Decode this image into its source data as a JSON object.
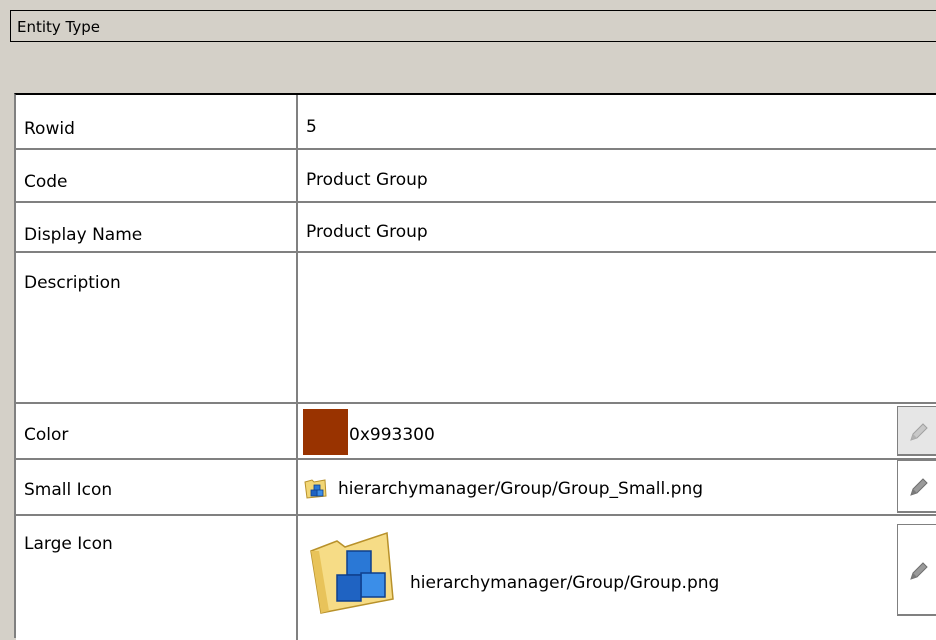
{
  "panel": {
    "title": "Entity Type"
  },
  "fields": {
    "rowid": {
      "label": "Rowid",
      "value": "5"
    },
    "code": {
      "label": "Code",
      "value": "Product Group"
    },
    "display_name": {
      "label": "Display Name",
      "value": "Product Group"
    },
    "description": {
      "label": "Description",
      "value": ""
    },
    "color": {
      "label": "Color",
      "value": "0x993300",
      "swatch": "#993300"
    },
    "small_icon": {
      "label": "Small Icon",
      "value": "hierarchymanager/Group/Group_Small.png",
      "icon": "folder-blocks-icon"
    },
    "large_icon": {
      "label": "Large Icon",
      "value": "hierarchymanager/Group/Group.png",
      "icon": "folder-blocks-icon"
    }
  },
  "icons": {
    "edit": "pencil-icon"
  },
  "colors": {
    "panel_bg": "#d4d0c8",
    "grid_line": "#808080"
  }
}
